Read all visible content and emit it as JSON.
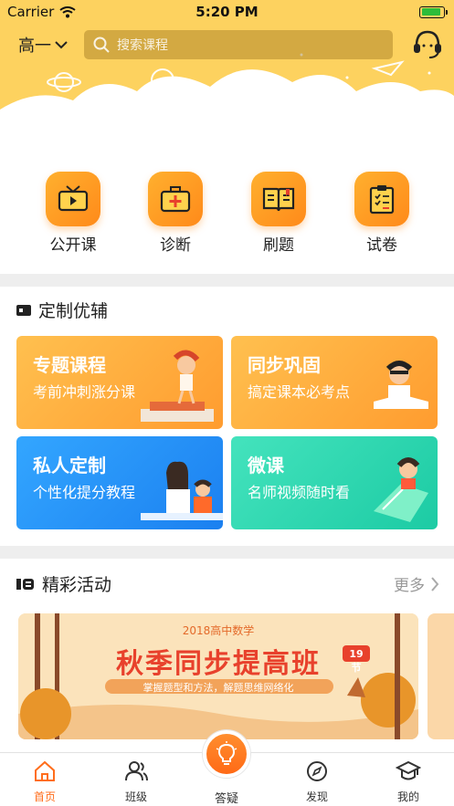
{
  "status_bar": {
    "carrier": "Carrier",
    "time": "5:20 PM",
    "battery_level": 0.9
  },
  "header": {
    "grade": "高一",
    "search_placeholder": "搜索课程"
  },
  "quick_entries": [
    {
      "label": "公开课",
      "icon": "tv-icon"
    },
    {
      "label": "诊断",
      "icon": "medical-kit-icon"
    },
    {
      "label": "刷题",
      "icon": "open-book-icon"
    },
    {
      "label": "试卷",
      "icon": "clipboard-checklist-icon"
    }
  ],
  "custom_section": {
    "title": "定制优辅",
    "cards": [
      {
        "title": "专题课程",
        "subtitle": "考前冲刺涨分课",
        "color_from": "#ffbd4d",
        "color_to": "#ff9a2e"
      },
      {
        "title": "同步巩固",
        "subtitle": "搞定课本必考点",
        "color_from": "#ffbd4d",
        "color_to": "#ff9a2e"
      },
      {
        "title": "私人定制",
        "subtitle": "个性化提分教程",
        "color_from": "#2fa0ff",
        "color_to": "#1b7ff0"
      },
      {
        "title": "微课",
        "subtitle": "名师视频随时看",
        "color_from": "#3ee0b8",
        "color_to": "#1ccba4"
      }
    ]
  },
  "activity_section": {
    "title": "精彩活动",
    "more_label": "更多",
    "banner": {
      "top_line": "2018高中数学",
      "headline": "秋季同步提高班",
      "badge": "19节",
      "tagline": "掌握题型和方法，解题思维网络化"
    }
  },
  "tab_bar": {
    "items": [
      {
        "label": "首页",
        "icon": "home-icon",
        "active": true
      },
      {
        "label": "班级",
        "icon": "users-icon",
        "active": false
      },
      {
        "label": "答疑",
        "icon": "lightbulb-icon",
        "active": false
      },
      {
        "label": "发现",
        "icon": "compass-icon",
        "active": false
      },
      {
        "label": "我的",
        "icon": "graduation-cap-icon",
        "active": false
      }
    ]
  },
  "colors": {
    "accent": "#ff6d1b",
    "hero_bg": "#fdd25f",
    "divider": "#eeeeee"
  }
}
